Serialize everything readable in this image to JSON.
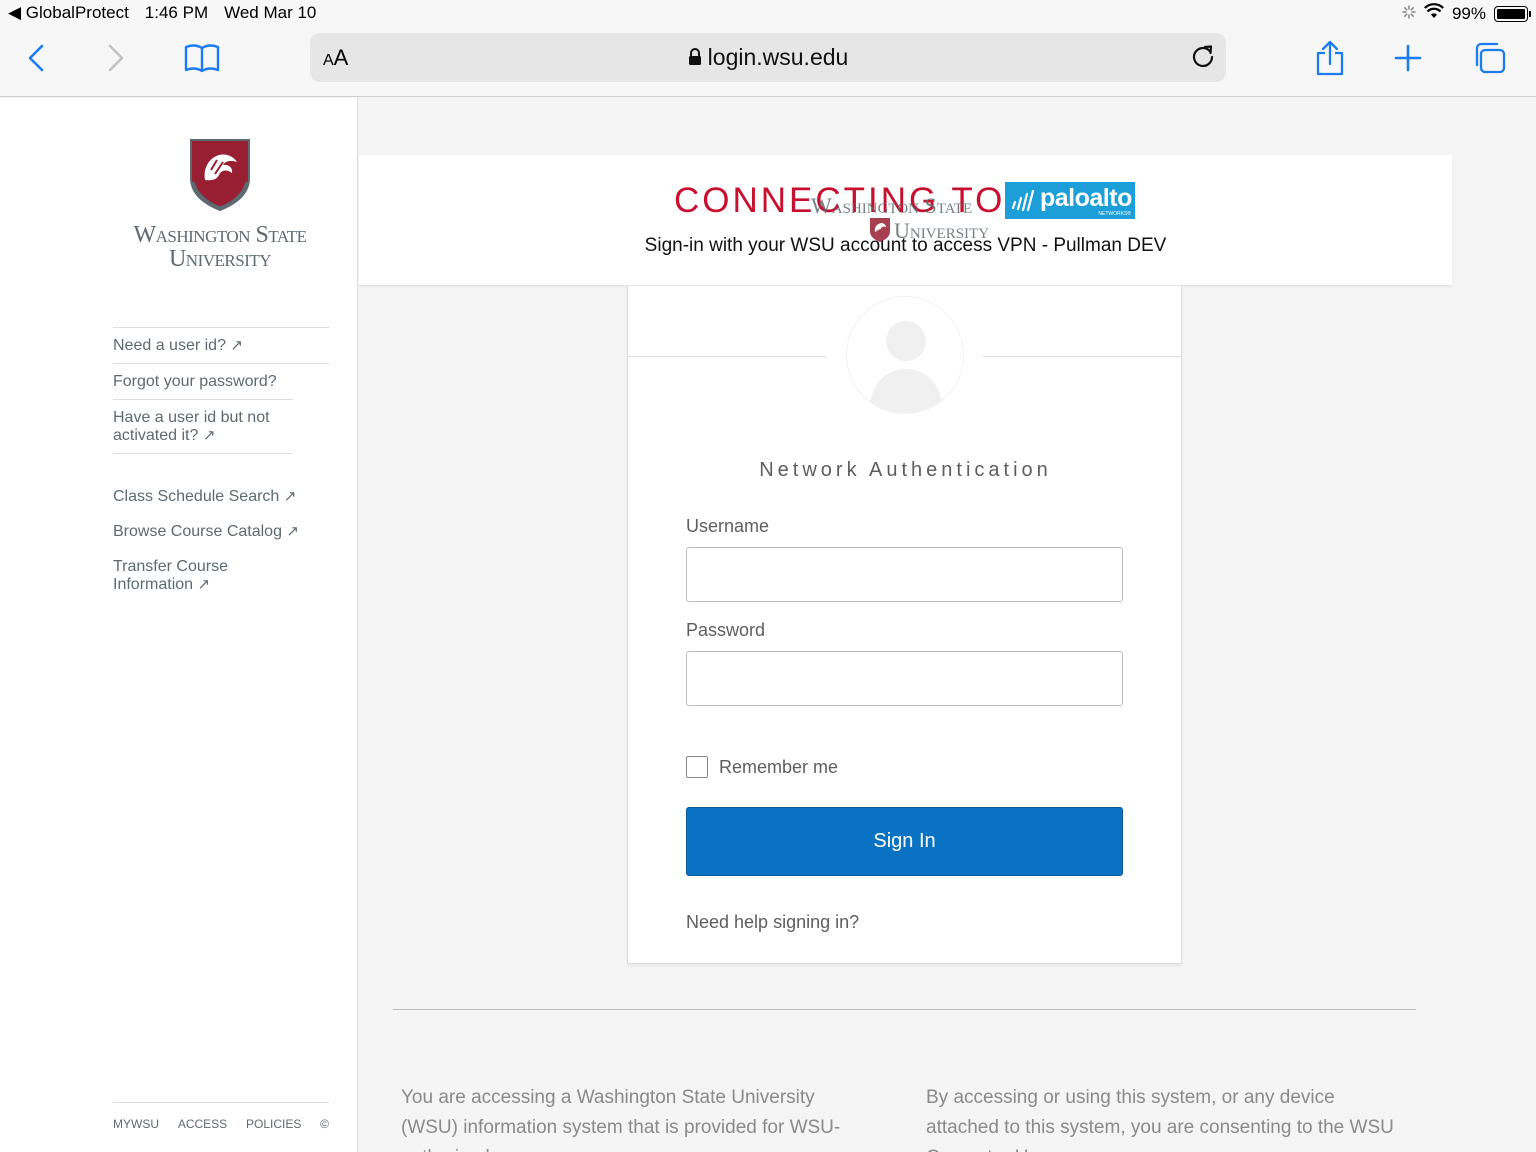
{
  "status_bar": {
    "back_app": "◀ GlobalProtect",
    "time": "1:46 PM",
    "date": "Wed Mar 10",
    "battery": "99%"
  },
  "browser": {
    "text_size_label": "A",
    "text_size_label_big": "A",
    "url": "login.wsu.edu"
  },
  "sidebar": {
    "logo_line1": "Washington State",
    "logo_line2": "University",
    "account_links": [
      "Need a user id?",
      "Forgot your password?",
      "Have a user id but not activated it?"
    ],
    "course_links": [
      "Class Schedule Search",
      "Browse Course Catalog",
      "Transfer Course Information"
    ],
    "footer_links": [
      "MYWSU",
      "ACCESS",
      "POLICIES",
      "©"
    ]
  },
  "banner": {
    "connecting": "CONNECTING TO",
    "paloalto_brand": "paloalto",
    "paloalto_sub": "NETWORKS®",
    "wsu_overlay_line1": "Washington State",
    "wsu_overlay_line2": "University",
    "subtitle": "Sign-in with your WSU account to access VPN - Pullman DEV"
  },
  "auth": {
    "heading": "Network Authentication",
    "username_label": "Username",
    "username_value": "",
    "password_label": "Password",
    "password_value": "",
    "remember_label": "Remember me",
    "sign_in_label": "Sign In",
    "help_link": "Need help signing in?"
  },
  "notice": {
    "left": "You are accessing a Washington State University (WSU) information system that is provided for WSU-authorized",
    "right": "By accessing or using this system, or any device attached to this system, you are consenting to the WSU Computer Use"
  },
  "colors": {
    "wsu_crimson": "#981e32",
    "accent_blue": "#1a7cf0",
    "sign_in_blue": "#0a72c2",
    "connecting_red": "#c8102e",
    "paloalto_blue": "#1c9ed9"
  }
}
